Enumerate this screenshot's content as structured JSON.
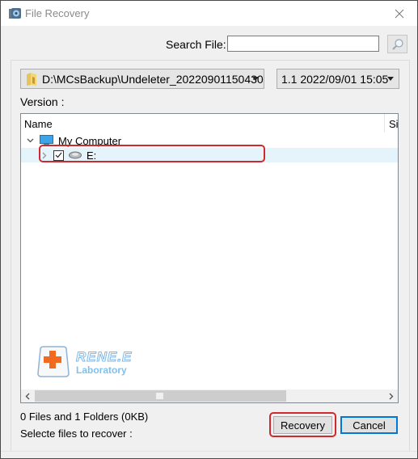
{
  "window": {
    "title": "File Recovery",
    "icon": "app-disk-icon",
    "close_icon": "close-icon"
  },
  "search": {
    "label": "Search File:",
    "value": "",
    "placeholder": "",
    "button_icon": "magnifier-icon"
  },
  "path_dropdown": {
    "icon": "folder-icon",
    "selected": "D:\\MCsBackup\\Undeleter_20220901150430"
  },
  "version_dropdown": {
    "selected": "1.1  2022/09/01 15:05"
  },
  "version_label": "Version :",
  "tree": {
    "columns": [
      "Name",
      "Si"
    ],
    "nodes": [
      {
        "label": "My Computer",
        "icon": "computer-icon",
        "expanded": true,
        "level": 0
      },
      {
        "label": "E:",
        "icon": "drive-icon",
        "expanded": false,
        "checked": true,
        "level": 1,
        "highlighted": true
      }
    ]
  },
  "watermark": {
    "brand": "RENE.E",
    "sub": "Laboratory"
  },
  "status": {
    "count_text": "0 Files and  1 Folders (0KB)",
    "select_text": "Selecte files to recover :"
  },
  "buttons": {
    "recovery": "Recovery",
    "cancel": "Cancel"
  },
  "colors": {
    "highlight_red": "#d0282f",
    "focus_blue": "#0078d7",
    "row_selected": "#e5f3fb"
  }
}
